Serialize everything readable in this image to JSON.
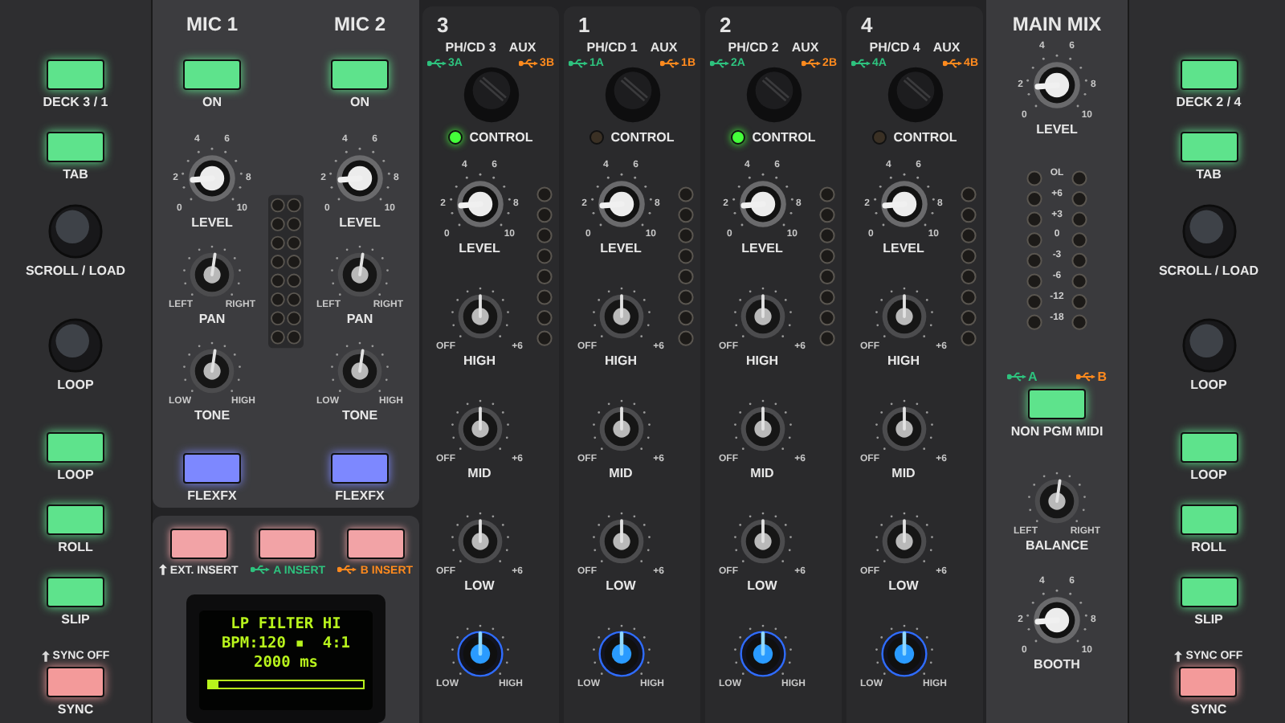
{
  "left_deck": {
    "controls": [
      {
        "kind": "button",
        "label": "DECK 3 / 1",
        "color": "#5ee38c"
      },
      {
        "kind": "button",
        "label": "TAB",
        "color": "#5ee38c"
      },
      {
        "kind": "encoder",
        "label": "SCROLL / LOAD"
      },
      {
        "kind": "encoder",
        "label": "LOOP"
      },
      {
        "kind": "button",
        "label": "LOOP",
        "color": "#5ee38c"
      },
      {
        "kind": "button",
        "label": "ROLL",
        "color": "#5ee38c"
      },
      {
        "kind": "button",
        "label": "SLIP",
        "color": "#5ee38c"
      },
      {
        "kind": "button",
        "label": "SYNC",
        "color": "#f39a9a",
        "shift_label": "SYNC OFF"
      }
    ]
  },
  "mic_channels": [
    {
      "title": "MIC 1",
      "on_button": {
        "label": "ON",
        "color": "#5ee38c"
      },
      "knobs": [
        {
          "kind": "level",
          "label": "LEVEL",
          "scale": [
            "0",
            "2",
            "4",
            "6",
            "8",
            "10"
          ]
        },
        {
          "kind": "pan",
          "label": "PAN",
          "min_label": "LEFT",
          "max_label": "RIGHT"
        },
        {
          "kind": "pan",
          "label": "TONE",
          "min_label": "LOW",
          "max_label": "HIGH"
        }
      ],
      "fx_button": {
        "label": "FLEXFX",
        "color": "#7d88ff"
      }
    },
    {
      "title": "MIC 2",
      "on_button": {
        "label": "ON",
        "color": "#5ee38c"
      },
      "knobs": [
        {
          "kind": "level",
          "label": "LEVEL",
          "scale": [
            "0",
            "2",
            "4",
            "6",
            "8",
            "10"
          ]
        },
        {
          "kind": "pan",
          "label": "PAN",
          "min_label": "LEFT",
          "max_label": "RIGHT"
        },
        {
          "kind": "pan",
          "label": "TONE",
          "min_label": "LOW",
          "max_label": "HIGH"
        }
      ],
      "fx_button": {
        "label": "FLEXFX",
        "color": "#7d88ff"
      }
    }
  ],
  "insert_section": {
    "buttons": [
      {
        "kind": "shift",
        "label": "EXT. INSERT",
        "color": "#e6e6e6"
      },
      {
        "kind": "usb",
        "label": "A INSERT",
        "color": "#2ec27e"
      },
      {
        "kind": "usb",
        "label": "B INSERT",
        "color": "#ff8a1e"
      }
    ],
    "display": {
      "lines": [
        "LP FILTER HI",
        "BPM:120 ▪  4:1",
        "2000 ms"
      ],
      "level": 0.06
    }
  },
  "channels": [
    {
      "number": "3",
      "source": "PH/CD 3",
      "aux": "AUX",
      "usb_a": "3A",
      "usb_b": "3B",
      "control": {
        "label": "CONTROL",
        "on": true
      },
      "knobs": [
        {
          "kind": "level",
          "label": "LEVEL",
          "scale": [
            "0",
            "2",
            "4",
            "6",
            "8",
            "10"
          ]
        },
        {
          "kind": "eq",
          "label": "HIGH",
          "min_label": "OFF",
          "max_label": "+6"
        },
        {
          "kind": "eq",
          "label": "MID",
          "min_label": "OFF",
          "max_label": "+6"
        },
        {
          "kind": "eq",
          "label": "LOW",
          "min_label": "OFF",
          "max_label": "+6"
        },
        {
          "kind": "filter",
          "min_label": "LOW",
          "max_label": "HIGH"
        }
      ]
    },
    {
      "number": "1",
      "source": "PH/CD 1",
      "aux": "AUX",
      "usb_a": "1A",
      "usb_b": "1B",
      "control": {
        "label": "CONTROL",
        "on": false
      },
      "knobs": [
        {
          "kind": "level",
          "label": "LEVEL",
          "scale": [
            "0",
            "2",
            "4",
            "6",
            "8",
            "10"
          ]
        },
        {
          "kind": "eq",
          "label": "HIGH",
          "min_label": "OFF",
          "max_label": "+6"
        },
        {
          "kind": "eq",
          "label": "MID",
          "min_label": "OFF",
          "max_label": "+6"
        },
        {
          "kind": "eq",
          "label": "LOW",
          "min_label": "OFF",
          "max_label": "+6"
        },
        {
          "kind": "filter",
          "min_label": "LOW",
          "max_label": "HIGH"
        }
      ]
    },
    {
      "number": "2",
      "source": "PH/CD 2",
      "aux": "AUX",
      "usb_a": "2A",
      "usb_b": "2B",
      "control": {
        "label": "CONTROL",
        "on": true
      },
      "knobs": [
        {
          "kind": "level",
          "label": "LEVEL",
          "scale": [
            "0",
            "2",
            "4",
            "6",
            "8",
            "10"
          ]
        },
        {
          "kind": "eq",
          "label": "HIGH",
          "min_label": "OFF",
          "max_label": "+6"
        },
        {
          "kind": "eq",
          "label": "MID",
          "min_label": "OFF",
          "max_label": "+6"
        },
        {
          "kind": "eq",
          "label": "LOW",
          "min_label": "OFF",
          "max_label": "+6"
        },
        {
          "kind": "filter",
          "min_label": "LOW",
          "max_label": "HIGH"
        }
      ]
    },
    {
      "number": "4",
      "source": "PH/CD 4",
      "aux": "AUX",
      "usb_a": "4A",
      "usb_b": "4B",
      "control": {
        "label": "CONTROL",
        "on": false
      },
      "knobs": [
        {
          "kind": "level",
          "label": "LEVEL",
          "scale": [
            "0",
            "2",
            "4",
            "6",
            "8",
            "10"
          ]
        },
        {
          "kind": "eq",
          "label": "HIGH",
          "min_label": "OFF",
          "max_label": "+6"
        },
        {
          "kind": "eq",
          "label": "MID",
          "min_label": "OFF",
          "max_label": "+6"
        },
        {
          "kind": "eq",
          "label": "LOW",
          "min_label": "OFF",
          "max_label": "+6"
        },
        {
          "kind": "filter",
          "min_label": "LOW",
          "max_label": "HIGH"
        }
      ]
    }
  ],
  "main_mix": {
    "title": "MAIN MIX",
    "level_knob": {
      "kind": "level",
      "label": "LEVEL",
      "scale": [
        "0",
        "2",
        "4",
        "6",
        "8",
        "10"
      ]
    },
    "meter_labels": [
      "OL",
      "+6",
      "+3",
      "0",
      "-3",
      "-6",
      "-12",
      "-18"
    ],
    "usb_a": "A",
    "usb_b": "B",
    "midi_button": {
      "label": "NON PGM MIDI",
      "color": "#5ee38c"
    },
    "balance_knob": {
      "kind": "pan",
      "label": "BALANCE",
      "min_label": "LEFT",
      "max_label": "RIGHT"
    },
    "booth_knob": {
      "kind": "level",
      "label": "BOOTH",
      "scale": [
        "0",
        "2",
        "4",
        "6",
        "8",
        "10"
      ]
    }
  },
  "right_deck": {
    "controls": [
      {
        "kind": "button",
        "label": "DECK 2 / 4",
        "color": "#5ee38c"
      },
      {
        "kind": "button",
        "label": "TAB",
        "color": "#5ee38c"
      },
      {
        "kind": "encoder",
        "label": "SCROLL / LOAD"
      },
      {
        "kind": "encoder",
        "label": "LOOP"
      },
      {
        "kind": "button",
        "label": "LOOP",
        "color": "#5ee38c"
      },
      {
        "kind": "button",
        "label": "ROLL",
        "color": "#5ee38c"
      },
      {
        "kind": "button",
        "label": "SLIP",
        "color": "#5ee38c"
      },
      {
        "kind": "button",
        "label": "SYNC",
        "color": "#f39a9a",
        "shift_label": "SYNC OFF"
      }
    ]
  }
}
